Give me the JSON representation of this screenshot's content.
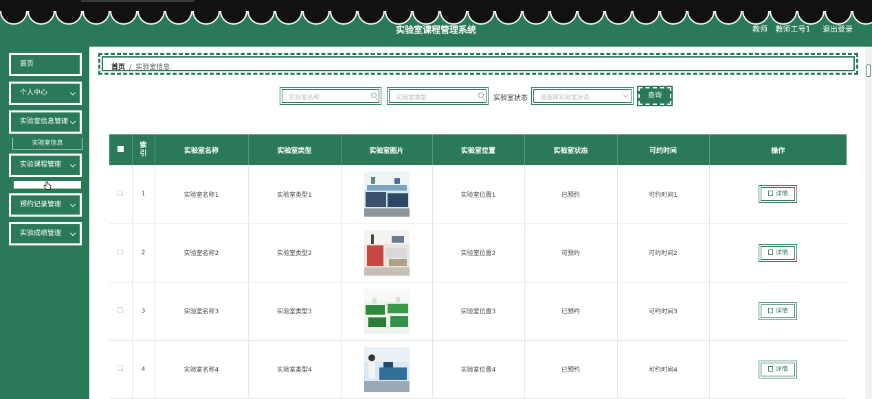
{
  "header": {
    "title": "实验室课程管理系统",
    "user_role": "教师",
    "user_name": "教师工号1",
    "logout": "退出登录"
  },
  "sidebar": {
    "items": [
      {
        "label": "首页",
        "has_chevron": false
      },
      {
        "label": "个人中心",
        "has_chevron": true
      },
      {
        "label": "实验室信息管理",
        "has_chevron": true
      },
      {
        "label": "实验课程管理",
        "has_chevron": true
      },
      {
        "label": "预约记录管理",
        "has_chevron": true
      },
      {
        "label": "实验成绩管理",
        "has_chevron": true
      }
    ],
    "subitem": "实验室信息"
  },
  "breadcrumb": {
    "home": "首页",
    "separator": "/",
    "current": "实验室信息"
  },
  "search": {
    "name_placeholder": "实验室名称",
    "type_placeholder": "实验室类型",
    "status_label": "实验室状态",
    "status_placeholder": "请选择实验室状态",
    "query_button": "查询"
  },
  "table": {
    "columns": [
      "索引",
      "实验室名称",
      "实验室类型",
      "实验室图片",
      "实验室位置",
      "实验室状态",
      "可约时间",
      "操作"
    ],
    "rows": [
      {
        "index": "1",
        "name": "实验室名称1",
        "type": "实验室类型1",
        "location": "实验室位置1",
        "status": "已预约",
        "time": "可约时间1",
        "action": "详情"
      },
      {
        "index": "2",
        "name": "实验室名称2",
        "type": "实验室类型2",
        "location": "实验室位置2",
        "status": "可预约",
        "time": "可约时间2",
        "action": "详情"
      },
      {
        "index": "3",
        "name": "实验室名称3",
        "type": "实验室类型3",
        "location": "实验室位置3",
        "status": "已预约",
        "time": "可约时间3",
        "action": "详情"
      },
      {
        "index": "4",
        "name": "实验室名称4",
        "type": "实验室类型4",
        "location": "实验室位置4",
        "status": "已预约",
        "time": "可约时间4",
        "action": "详情"
      }
    ]
  },
  "colors": {
    "primary": "#2a7a5a",
    "header_text": "#ffffff",
    "top_strip": "#111111"
  }
}
